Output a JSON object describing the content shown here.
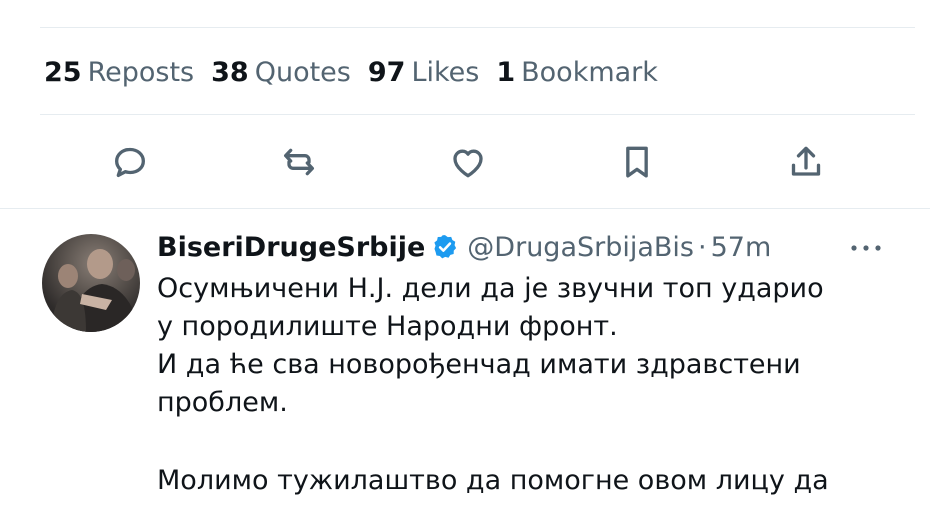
{
  "stats": {
    "reposts": {
      "count": "25",
      "label": "Reposts"
    },
    "quotes": {
      "count": "38",
      "label": "Quotes"
    },
    "likes": {
      "count": "97",
      "label": "Likes"
    },
    "bookmarks": {
      "count": "1",
      "label": "Bookmark"
    }
  },
  "actions": [
    {
      "name": "reply",
      "icon": "reply-icon"
    },
    {
      "name": "repost",
      "icon": "repost-icon"
    },
    {
      "name": "like",
      "icon": "heart-icon"
    },
    {
      "name": "bookmark",
      "icon": "bookmark-icon"
    },
    {
      "name": "share",
      "icon": "share-icon"
    }
  ],
  "reply_tweet": {
    "display_name": "BiseriDrugeSrbije",
    "handle": "@DrugaSrbijaBis",
    "separator": "·",
    "time": "57m",
    "text_lines": [
      "Осумњичени Н.Ј. дели да је звучни топ ударио",
      "у породилиште Народни фронт.",
      "И да ће сва новорођенчад имати здравстени",
      "проблем.",
      "",
      "Молимо тужилаштво да помогне овом лицу да"
    ]
  },
  "colors": {
    "text_primary": "#0f1419",
    "text_secondary": "#536471",
    "verified_blue": "#1d9bf0",
    "divider": "#e6ecf0"
  }
}
